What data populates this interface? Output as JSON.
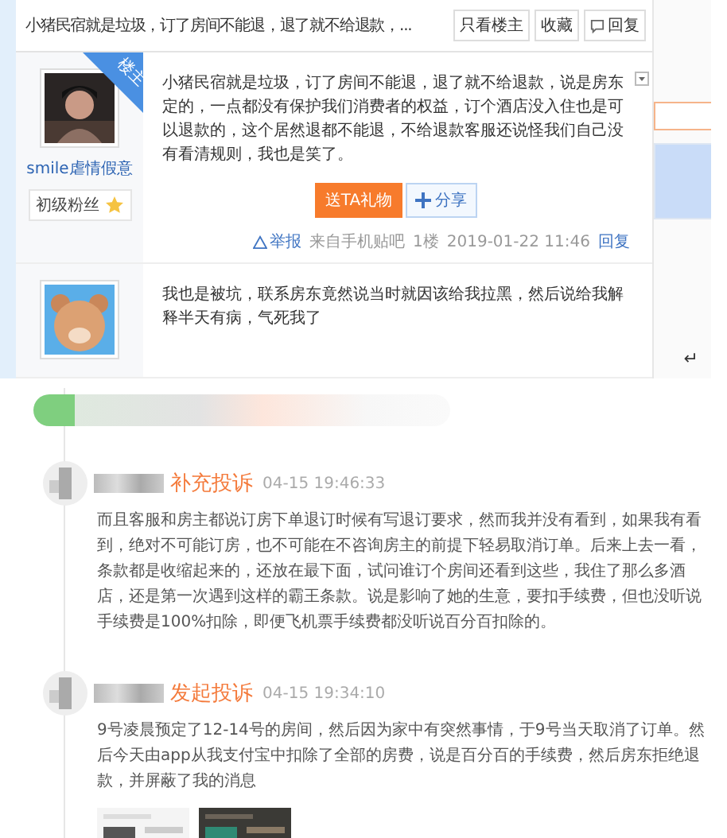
{
  "thread_header": {
    "title": "小猪民宿就是垃圾，订了房间不能退，退了就不给退款，...",
    "buttons": [
      {
        "label": "只看楼主",
        "kind": "plain"
      },
      {
        "label": "收藏",
        "kind": "plain"
      },
      {
        "label": "回复",
        "kind": "reply"
      }
    ]
  },
  "posts": [
    {
      "author": {
        "name": "smile虐情假意",
        "badge": "初级粉丝",
        "corner_tag": "楼主"
      },
      "content": "小猪民宿就是垃圾，订了房间不能退，退了就不给退款，说是房东定的，一点都没有保护我们消费者的权益，订个酒店没入住也是可以退款的，这个居然退都不能退，不给退款客服还说怪我们自己没有看清规则，我也是笑了。",
      "actions": [
        {
          "label": "送TA礼物",
          "kind": "gift"
        },
        {
          "label": "分享",
          "kind": "share"
        }
      ],
      "footer": {
        "report": "举报",
        "source": "来自手机贴吧",
        "floor": "1楼",
        "time": "2019-01-22 11:46",
        "reply": "回复"
      }
    },
    {
      "author": {
        "kind": "bear"
      },
      "content": "我也是被坑，联系房东竟然说当时就因该给我拉黑，然后说给我解释半天有病，气死我了"
    }
  ],
  "return_mark": "↵",
  "timeline": [
    {
      "action": "补充投诉",
      "time": "04-15 19:46:33",
      "text": "而且客服和房主都说订房下单退订时候有写退订要求，然而我并没有看到，如果我有看到，绝对不可能订房，也不可能在不咨询房主的前提下轻易取消订单。后来上去一看，条款都是收缩起来的，还放在最下面，试问谁订个房间还看到这些，我住了那么多酒店，还是第一次遇到这样的霸王条款。说是影响了她的生意，要扣手续费，但也没听说手续费是100%扣除，即便飞机票手续费都没听说百分百扣除的。"
    },
    {
      "action": "发起投诉",
      "time": "04-15 19:34:10",
      "text": "9号凌晨预定了12-14号的房间，然后因为家中有突然事情，于9号当天取消了订单。然后今天由app从我支付宝中扣除了全部的房费，说是百分百的手续费，然后房东拒绝退款，并屏蔽了我的消息"
    }
  ]
}
